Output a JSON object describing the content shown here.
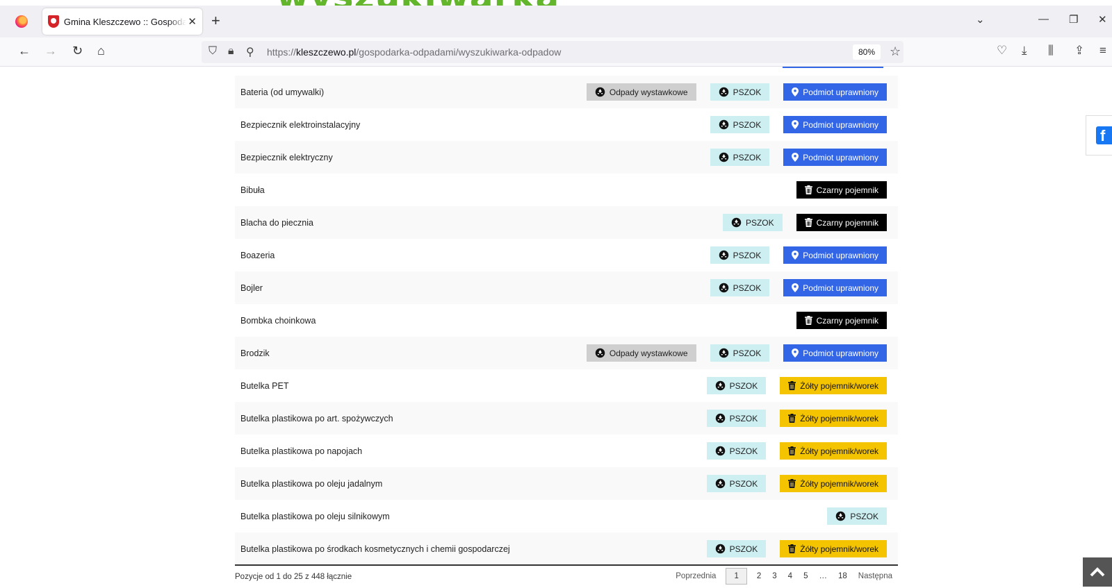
{
  "page_heading_partial": "wyszukiwarka",
  "browser": {
    "tab_title": "Gmina Kleszczewo :: Gospodarka odpadami",
    "url_prefix": "https://",
    "url_domain": "kleszczewo.pl",
    "url_path": "/gospodarka-odpadami/wyszukiwarka-odpadow",
    "zoom": "80%"
  },
  "rows": [
    {
      "name": "Bateria (od umywalki)",
      "badges": [
        {
          "type": "grey",
          "label": "Odpady wystawkowe"
        },
        {
          "type": "pszok",
          "label": "PSZOK"
        },
        {
          "type": "blue",
          "label": "Podmiot uprawniony"
        }
      ]
    },
    {
      "name": "Bezpiecznik elektroinstalacyjny",
      "badges": [
        {
          "type": "pszok",
          "label": "PSZOK"
        },
        {
          "type": "blue",
          "label": "Podmiot uprawniony"
        }
      ]
    },
    {
      "name": "Bezpiecznik elektryczny",
      "badges": [
        {
          "type": "pszok",
          "label": "PSZOK"
        },
        {
          "type": "blue",
          "label": "Podmiot uprawniony"
        }
      ]
    },
    {
      "name": "Bibuła",
      "badges": [
        {
          "type": "black",
          "label": "Czarny pojemnik"
        }
      ]
    },
    {
      "name": "Blacha do piecznia",
      "badges": [
        {
          "type": "pszok",
          "label": "PSZOK"
        },
        {
          "type": "black",
          "label": "Czarny pojemnik"
        }
      ]
    },
    {
      "name": "Boazeria",
      "badges": [
        {
          "type": "pszok",
          "label": "PSZOK"
        },
        {
          "type": "blue",
          "label": "Podmiot uprawniony"
        }
      ]
    },
    {
      "name": "Bojler",
      "badges": [
        {
          "type": "pszok",
          "label": "PSZOK"
        },
        {
          "type": "blue",
          "label": "Podmiot uprawniony"
        }
      ]
    },
    {
      "name": "Bombka choinkowa",
      "badges": [
        {
          "type": "black",
          "label": "Czarny pojemnik"
        }
      ]
    },
    {
      "name": "Brodzik",
      "badges": [
        {
          "type": "grey",
          "label": "Odpady wystawkowe"
        },
        {
          "type": "pszok",
          "label": "PSZOK"
        },
        {
          "type": "blue",
          "label": "Podmiot uprawniony"
        }
      ]
    },
    {
      "name": "Butelka PET",
      "badges": [
        {
          "type": "pszok",
          "label": "PSZOK"
        },
        {
          "type": "yellow",
          "label": "Żółty pojemnik/worek"
        }
      ]
    },
    {
      "name": "Butelka plastikowa po art. spożywczych",
      "badges": [
        {
          "type": "pszok",
          "label": "PSZOK"
        },
        {
          "type": "yellow",
          "label": "Żółty pojemnik/worek"
        }
      ]
    },
    {
      "name": "Butelka plastikowa po napojach",
      "badges": [
        {
          "type": "pszok",
          "label": "PSZOK"
        },
        {
          "type": "yellow",
          "label": "Żółty pojemnik/worek"
        }
      ]
    },
    {
      "name": "Butelka plastikowa po oleju jadalnym",
      "badges": [
        {
          "type": "pszok",
          "label": "PSZOK"
        },
        {
          "type": "yellow",
          "label": "Żółty pojemnik/worek"
        }
      ]
    },
    {
      "name": "Butelka plastikowa po oleju silnikowym",
      "badges": [
        {
          "type": "pszok",
          "label": "PSZOK"
        }
      ]
    },
    {
      "name": "Butelka plastikowa po środkach kosmetycznych i chemii gospodarczej",
      "badges": [
        {
          "type": "pszok",
          "label": "PSZOK"
        },
        {
          "type": "yellow",
          "label": "Żółty pojemnik/worek"
        }
      ]
    }
  ],
  "footer": {
    "info": "Pozycje od 1 do 25 z 448 łącznie",
    "prev_label": "Poprzednia",
    "next_label": "Następna",
    "pages": [
      "1",
      "2",
      "3",
      "4",
      "5",
      "…",
      "18"
    ],
    "current_page": "1"
  },
  "colors": {
    "grey_badge": "#cfcfcf",
    "pszok_badge": "#cdeff2",
    "blue_badge": "#3366e6",
    "black_badge": "#000000",
    "yellow_badge": "#f5c400",
    "brand_green": "#63b52b"
  }
}
